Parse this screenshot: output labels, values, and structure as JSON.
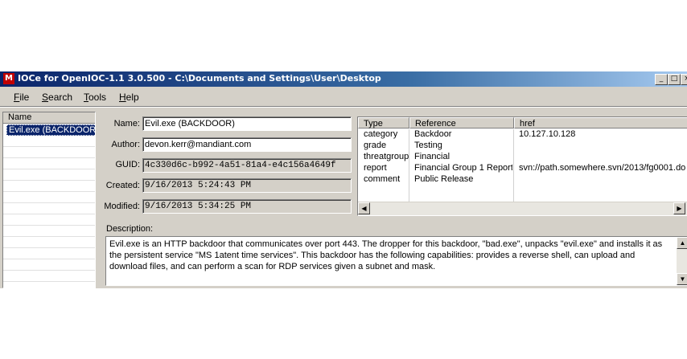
{
  "window": {
    "title": "IOCe for OpenIOC-1.1 3.0.500 - C:\\Documents and Settings\\User\\Desktop",
    "icon_label": "M",
    "controls": {
      "minimize": "_",
      "maximize": "□",
      "close": "×"
    }
  },
  "menu": {
    "items": [
      {
        "label": "File",
        "key": "F",
        "rest": "ile"
      },
      {
        "label": "Search",
        "key": "S",
        "rest": "earch"
      },
      {
        "label": "Tools",
        "key": "T",
        "rest": "ools"
      },
      {
        "label": "Help",
        "key": "H",
        "rest": "elp"
      }
    ]
  },
  "ioc_list": {
    "header": "Name",
    "items": [
      "Evil.exe (BACKDOOR)"
    ]
  },
  "details": {
    "name_label": "Name:",
    "name_value": "Evil.exe (BACKDOOR)",
    "author_label": "Author:",
    "author_value": "devon.kerr@mandiant.com",
    "guid_label": "GUID:",
    "guid_value": "4c330d6c-b992-4a51-81a4-e4c156a4649f",
    "created_label": "Created:",
    "created_value": "9/16/2013 5:24:43 PM",
    "modified_label": "Modified:",
    "modified_value": "9/16/2013 5:34:25 PM"
  },
  "params": {
    "columns": [
      "Type",
      "Reference",
      "href"
    ],
    "rows": [
      {
        "type": "category",
        "reference": "Backdoor",
        "href": "10.127.10.128"
      },
      {
        "type": "grade",
        "reference": "Testing",
        "href": ""
      },
      {
        "type": "threatgroup",
        "reference": "Financial",
        "href": ""
      },
      {
        "type": "report",
        "reference": "Financial Group 1 Report",
        "href": "svn://path.somewhere.svn/2013/fg0001.do"
      },
      {
        "type": "comment",
        "reference": "Public Release",
        "href": ""
      }
    ]
  },
  "description": {
    "label": "Description:",
    "text": "Evil.exe is an HTTP backdoor that communicates over port 443.  The dropper for this backdoor, \"bad.exe\", unpacks \"evil.exe\" and installs it as the persistent service \"MS 1atent time services\".  This backdoor has the following capabilities:  provides a reverse shell, can upload and download files, and can perform a scan for RDP services given a subnet and mask."
  }
}
